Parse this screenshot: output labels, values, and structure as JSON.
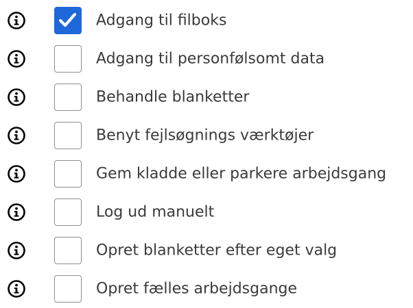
{
  "permissions": {
    "items": [
      {
        "label": "Adgang til filboks",
        "checked": true
      },
      {
        "label": "Adgang til personfølsomt data",
        "checked": false
      },
      {
        "label": "Behandle blanketter",
        "checked": false
      },
      {
        "label": "Benyt fejlsøgnings værktøjer",
        "checked": false
      },
      {
        "label": "Gem kladde eller parkere arbejdsgang",
        "checked": false
      },
      {
        "label": "Log ud manuelt",
        "checked": false
      },
      {
        "label": "Opret blanketter efter eget valg",
        "checked": false
      },
      {
        "label": "Opret fælles arbejdsgange",
        "checked": false
      }
    ]
  },
  "colors": {
    "checkbox_checked": "#1f68d9",
    "checkbox_border": "#8d8d8d",
    "label_text": "#3a3a3a",
    "icon": "#000000"
  },
  "icons": {
    "info": "info-icon",
    "check": "checkmark-icon"
  }
}
